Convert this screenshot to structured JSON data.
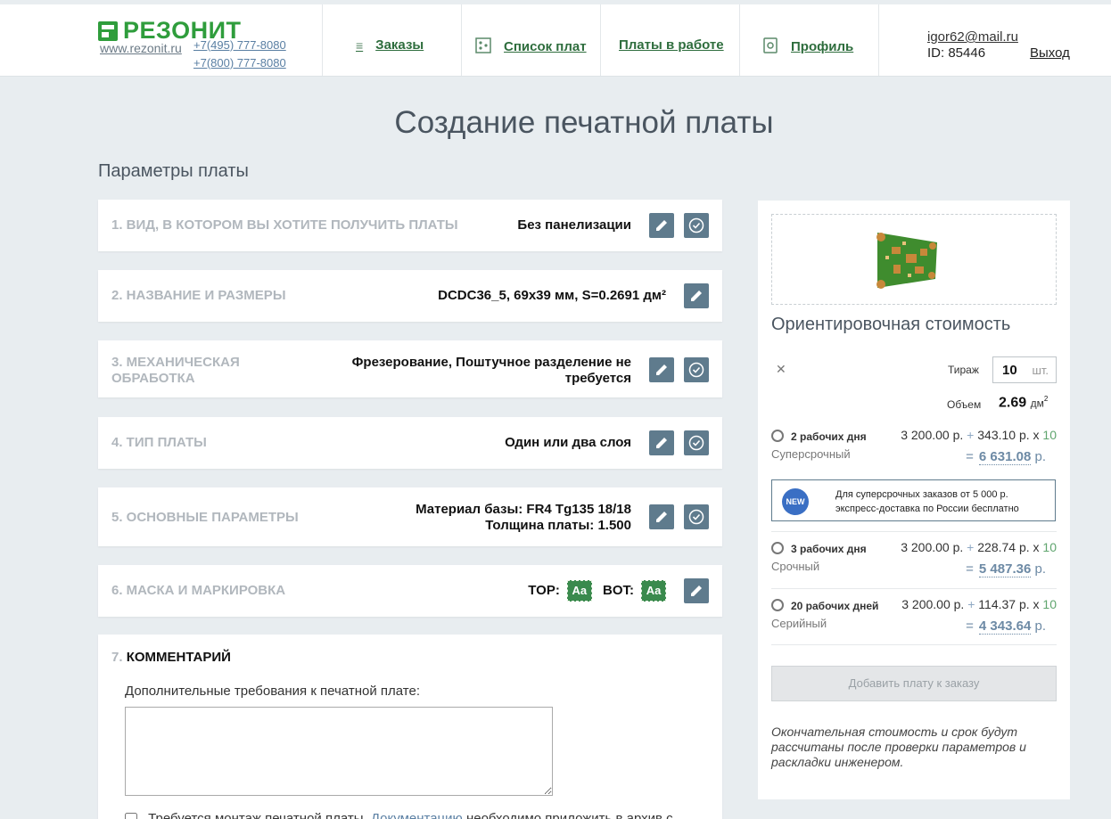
{
  "header": {
    "logo": "РЕЗОНИТ",
    "site": "www.rezonit.ru",
    "phone1": "+7(495) 777-8080",
    "phone2": "+7(800) 777-8080",
    "nav": {
      "orders": "Заказы",
      "boards": "Список плат",
      "in_work": "Платы в работе",
      "profile": "Профиль"
    },
    "email": "igor62@mail.ru",
    "id": "ID: 85446",
    "logout": "Выход"
  },
  "page_title": "Создание печатной платы",
  "section_title": "Параметры платы",
  "steps": [
    {
      "label": "1. ВИД, В КОТОРОМ ВЫ ХОТИТЕ ПОЛУЧИТЬ ПЛАТЫ",
      "value": "Без панелизации"
    },
    {
      "label": "2. НАЗВАНИЕ И РАЗМЕРЫ",
      "value": "DCDC36_5, 69x39 мм, S=0.2691 дм²"
    },
    {
      "label_l1": "3. МЕХАНИЧЕСКАЯ",
      "label_l2": "ОБРАБОТКА",
      "value_l1": "Фрезерование, Поштучное разделение не",
      "value_l2": "требуется"
    },
    {
      "label": "4. ТИП ПЛАТЫ",
      "value": "Один или два слоя"
    },
    {
      "label": "5. ОСНОВНЫЕ ПАРАМЕТРЫ",
      "value_l1": "Материал базы: FR4 Tg135 18/18",
      "value_l2": "Толщина платы: 1.500"
    },
    {
      "label": "6. МАСКА И МАРКИРОВКА",
      "top": "TOP:",
      "bot": "BOT:",
      "chip": "Aa"
    },
    {
      "num": "7.",
      "label": "КОММЕНТАРИЙ",
      "comment_label": "Дополнительные требования к печатной плате:",
      "comment_value": "",
      "check_text": "Требуется монтаж печатной платы. ",
      "check_link": "Документацию",
      "check_rest": " необходимо приложить в архив с"
    }
  ],
  "side": {
    "title": "Ориентировочная стоимость",
    "close": "✕",
    "tirazh_label": "Тираж",
    "tirazh_value": "10",
    "tirazh_unit": "шт.",
    "obem_label": "Объем",
    "obem_value": "2.69",
    "obem_unit": "дм",
    "obem_sup": "2",
    "options": [
      {
        "days": "2 рабочих дня",
        "kind": "Суперсрочный",
        "base": "3 200.00 р.",
        "plus": "+",
        "per": "343.10 р. x",
        "qty": "10",
        "eq": "=",
        "total": "6 631.08",
        "cur": "р."
      },
      {
        "days": "3 рабочих дня",
        "kind": "Срочный",
        "base": "3 200.00 р.",
        "plus": "+",
        "per": "228.74 р. x",
        "qty": "10",
        "eq": "=",
        "total": "5 487.36",
        "cur": "р."
      },
      {
        "days": "20 рабочих дней",
        "kind": "Серийный",
        "base": "3 200.00 р.",
        "plus": "+",
        "per": "114.37 р. x",
        "qty": "10",
        "eq": "=",
        "total": "4 343.64",
        "cur": "р."
      }
    ],
    "promo_badge": "NEW",
    "promo_l1": "Для суперсрочных заказов от 5 000 р.",
    "promo_l2": "экспресс-доставка по России бесплатно",
    "add_button": "Добавить плату к заказу",
    "note": "Окончательная стоимость и срок будут рассчитаны после проверки параметров и раскладки инженером."
  }
}
